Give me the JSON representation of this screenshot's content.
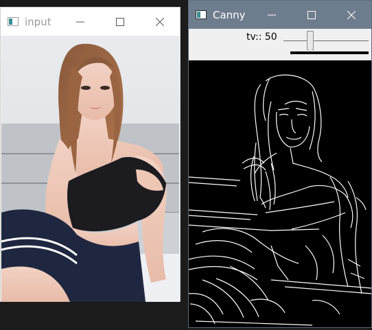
{
  "windows": {
    "input": {
      "title": "input"
    },
    "canny": {
      "title": "Canny"
    }
  },
  "trackbar": {
    "label": "tv:: 50",
    "value": 50
  },
  "icons": {
    "app_icon": "opencv-window-icon",
    "minimize": "minimize-icon",
    "maximize": "maximize-icon",
    "close": "close-icon"
  },
  "colors": {
    "canny_titlebar": "#6e7d8e",
    "input_titlebar": "#ffffff",
    "desktop": "#1b1b1b"
  }
}
